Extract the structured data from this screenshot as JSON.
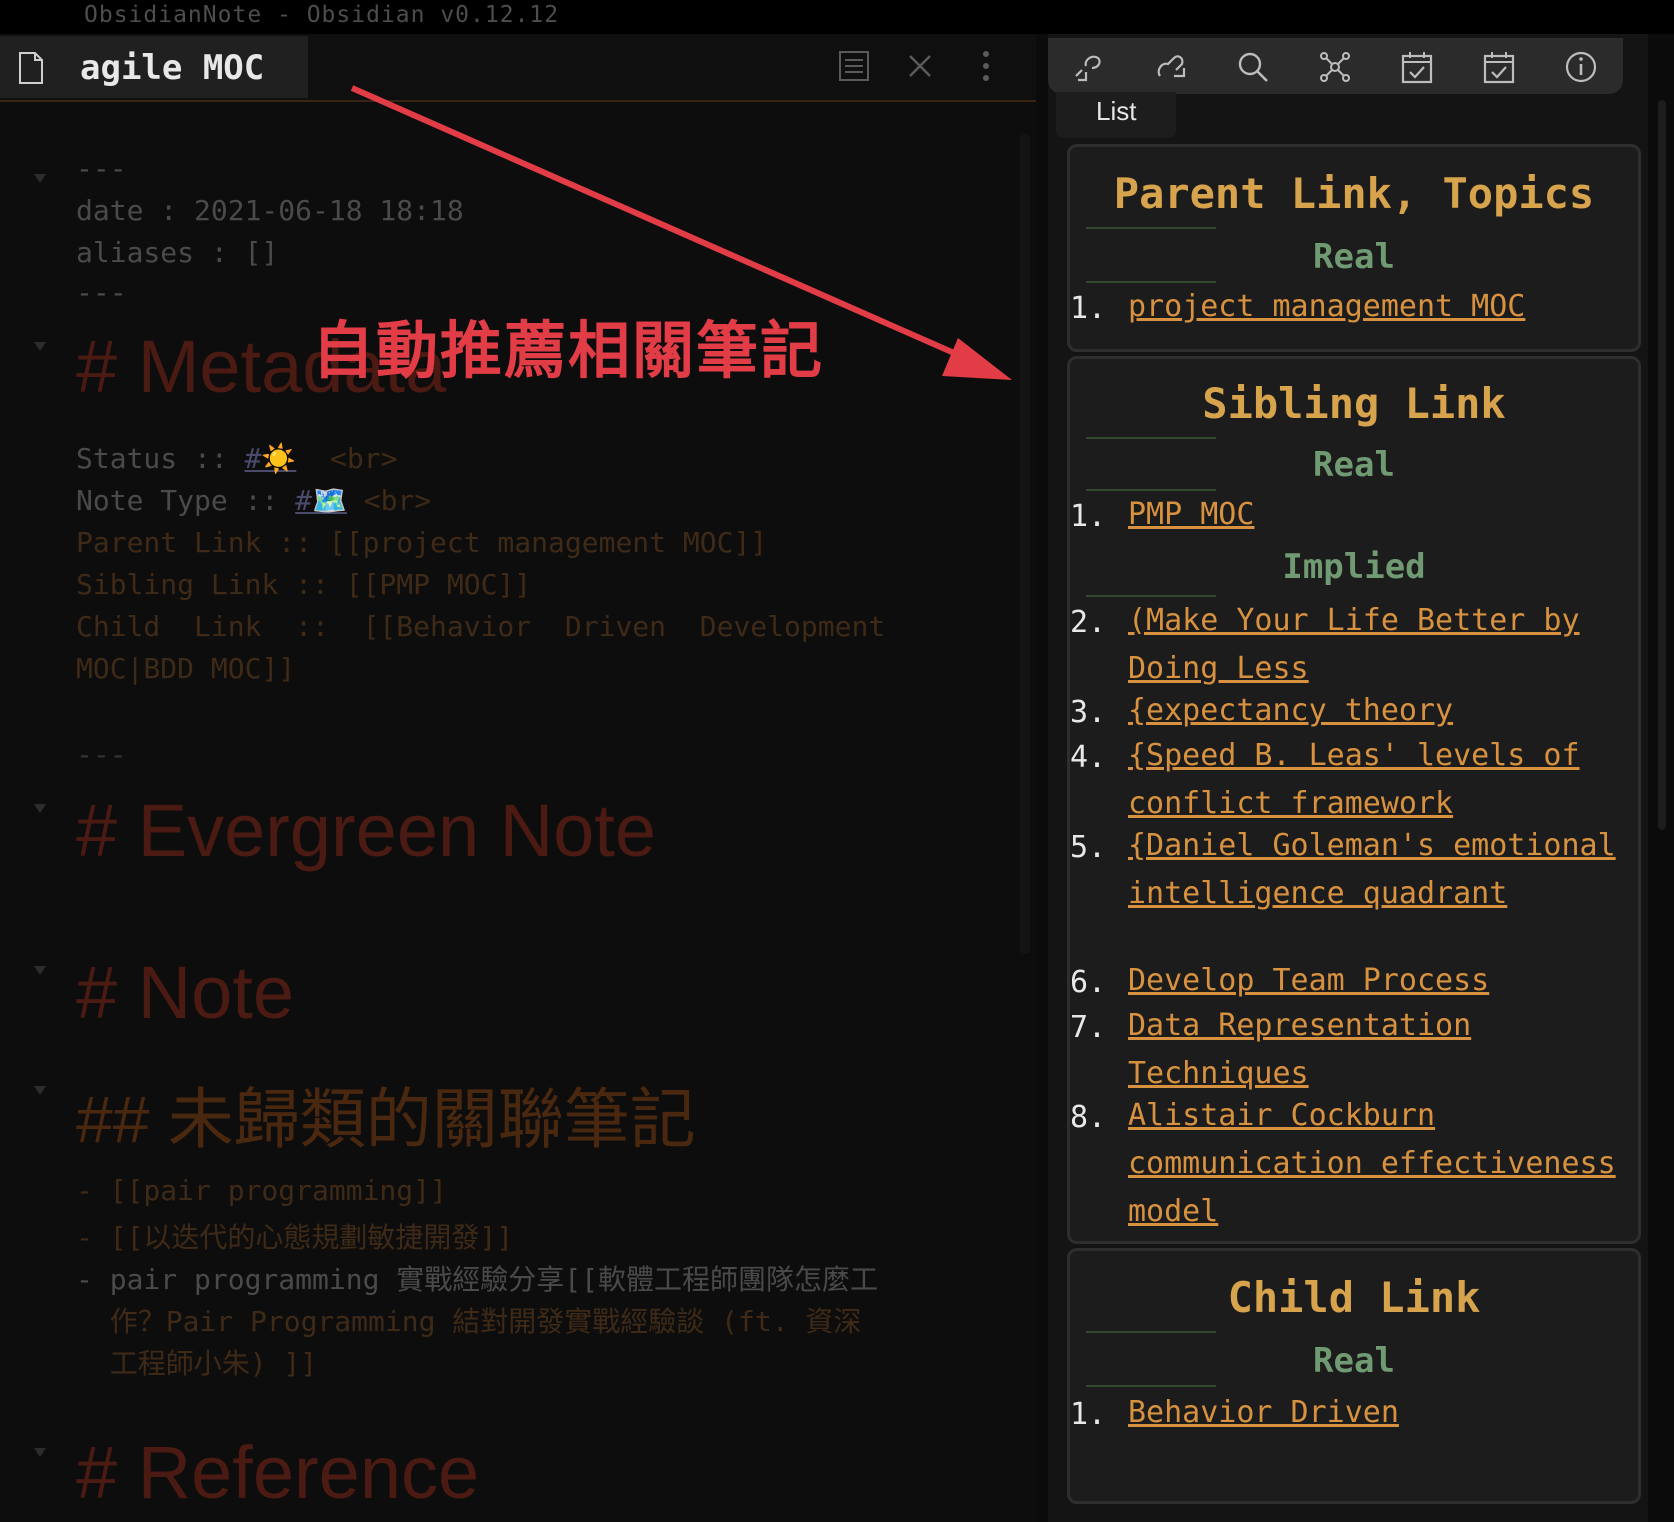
{
  "window": {
    "title": "ObsidianNote - Obsidian v0.12.12"
  },
  "editor": {
    "tab_title": "agile MOC",
    "frontmatter": {
      "open": "---",
      "date": "date : 2021-06-18 18:18",
      "aliases": "aliases : []",
      "close": "---"
    },
    "h1_metadata": "# Metadata",
    "metadata": {
      "status_label": "Status :: ",
      "status_tag": "#☀️",
      "status_br": "  <br>",
      "note_type_label": "Note Type :: ",
      "note_type_tag": "#🗺️",
      "note_type_br": " <br>",
      "parent_line": "Parent Link :: [[project management MOC]]",
      "sibling_line": "Sibling Link :: [[PMP MOC]]",
      "child_line_1": "Child  Link  ::  [[Behavior  Driven  Development",
      "child_line_2": "MOC|BDD MOC]]"
    },
    "hr": "---",
    "h1_evergreen": "# Evergreen Note",
    "h1_note": "# Note",
    "h2_unclassified": "## 未歸類的關聯筆記",
    "list": {
      "item1": "- [[pair programming]]",
      "item2": "- [[以迭代的心態規劃敏捷開發]]",
      "item3_line1": "- pair programming 實戰經驗分享[[軟體工程師團隊怎麼工",
      "item3_line2": "  作？Pair Programming 結對開發實戰經驗談 (ft. 資深",
      "item3_line3": "  工程師小朱) ]]"
    },
    "h1_reference": "# Reference"
  },
  "annotation": {
    "text": "自動推薦相關筆記",
    "color": "#e23c46"
  },
  "sidebar": {
    "tab_label": "List",
    "toolbar_icons": [
      "backlinks-icon",
      "outgoing-links-icon",
      "search-icon",
      "graph-icon",
      "calendar-check-icon",
      "calendar-check-icon",
      "info-icon"
    ],
    "cards": {
      "parent": {
        "title": "Parent Link, Topics",
        "real_label": "Real",
        "items": [
          {
            "num": "1.",
            "text": "project management MOC"
          }
        ]
      },
      "sibling": {
        "title": "Sibling Link",
        "real_label": "Real",
        "implied_label": "Implied",
        "items": [
          {
            "num": "1.",
            "text": "PMP MOC"
          },
          {
            "num": "2.",
            "text": "(Make Your Life Better by Doing Less"
          },
          {
            "num": "3.",
            "text": "{expectancy theory"
          },
          {
            "num": "4.",
            "text": "{Speed B. Leas' levels of conflict framework"
          },
          {
            "num": "5.",
            "text": "{Daniel Goleman's emotional intelligence quadrant"
          },
          {
            "num": "6.",
            "text": "Develop Team Process"
          },
          {
            "num": "7.",
            "text": "Data Representation Techniques"
          },
          {
            "num": "8.",
            "text": "Alistair Cockburn communication effectiveness model"
          }
        ]
      },
      "child": {
        "title": "Child Link",
        "real_label": "Real",
        "items": [
          {
            "num": "1.",
            "text": "Behavior Driven"
          }
        ]
      }
    }
  },
  "colors": {
    "link_orange": "#d8923f",
    "heading_gold": "#d7a34c",
    "sub_green": "#6f9a72"
  }
}
